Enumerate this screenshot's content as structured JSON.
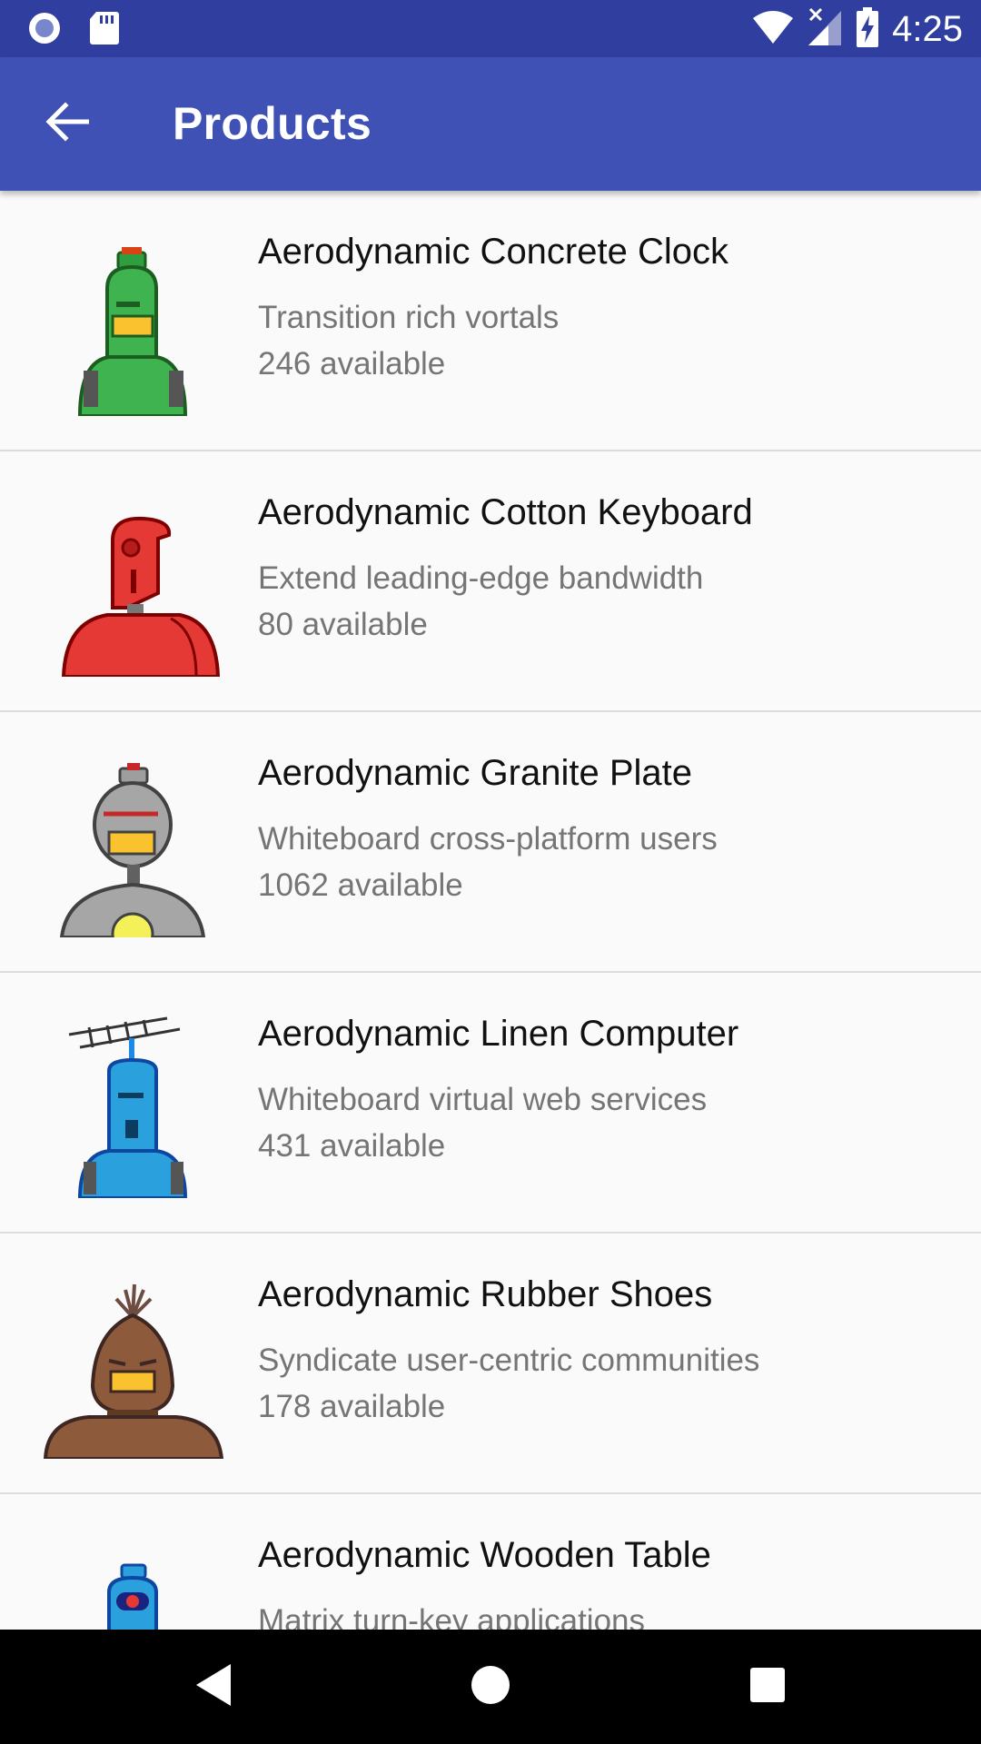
{
  "status_bar": {
    "time": "4:25",
    "icons": [
      "notification-dot-icon",
      "sd-card-icon",
      "wifi-icon",
      "cell-signal-off-icon",
      "battery-charging-icon"
    ]
  },
  "app_bar": {
    "title": "Products",
    "back_icon": "arrow-back-icon",
    "color": "#3f51b5",
    "status_color": "#303f9f"
  },
  "products": [
    {
      "title": "Aerodynamic Concrete Clock",
      "description": "Transition rich vortals",
      "availability": "246 available",
      "robot_color": "#2e9e3e"
    },
    {
      "title": "Aerodynamic Cotton Keyboard",
      "description": "Extend leading-edge bandwidth",
      "availability": "80 available",
      "robot_color": "#e02424"
    },
    {
      "title": "Aerodynamic Granite Plate",
      "description": "Whiteboard cross-platform users",
      "availability": "1062 available",
      "robot_color": "#8c8c8c"
    },
    {
      "title": "Aerodynamic Linen Computer",
      "description": "Whiteboard virtual web services",
      "availability": "431 available",
      "robot_color": "#2a9fd8"
    },
    {
      "title": "Aerodynamic Rubber Shoes",
      "description": "Syndicate user-centric communities",
      "availability": "178 available",
      "robot_color": "#7a4a2a"
    },
    {
      "title": "Aerodynamic Wooden Table",
      "description": "Matrix turn-key applications",
      "availability": "",
      "robot_color": "#2a9fd8"
    }
  ],
  "nav_bar": {
    "icons": [
      "back-triangle-icon",
      "home-circle-icon",
      "recents-square-icon"
    ]
  }
}
